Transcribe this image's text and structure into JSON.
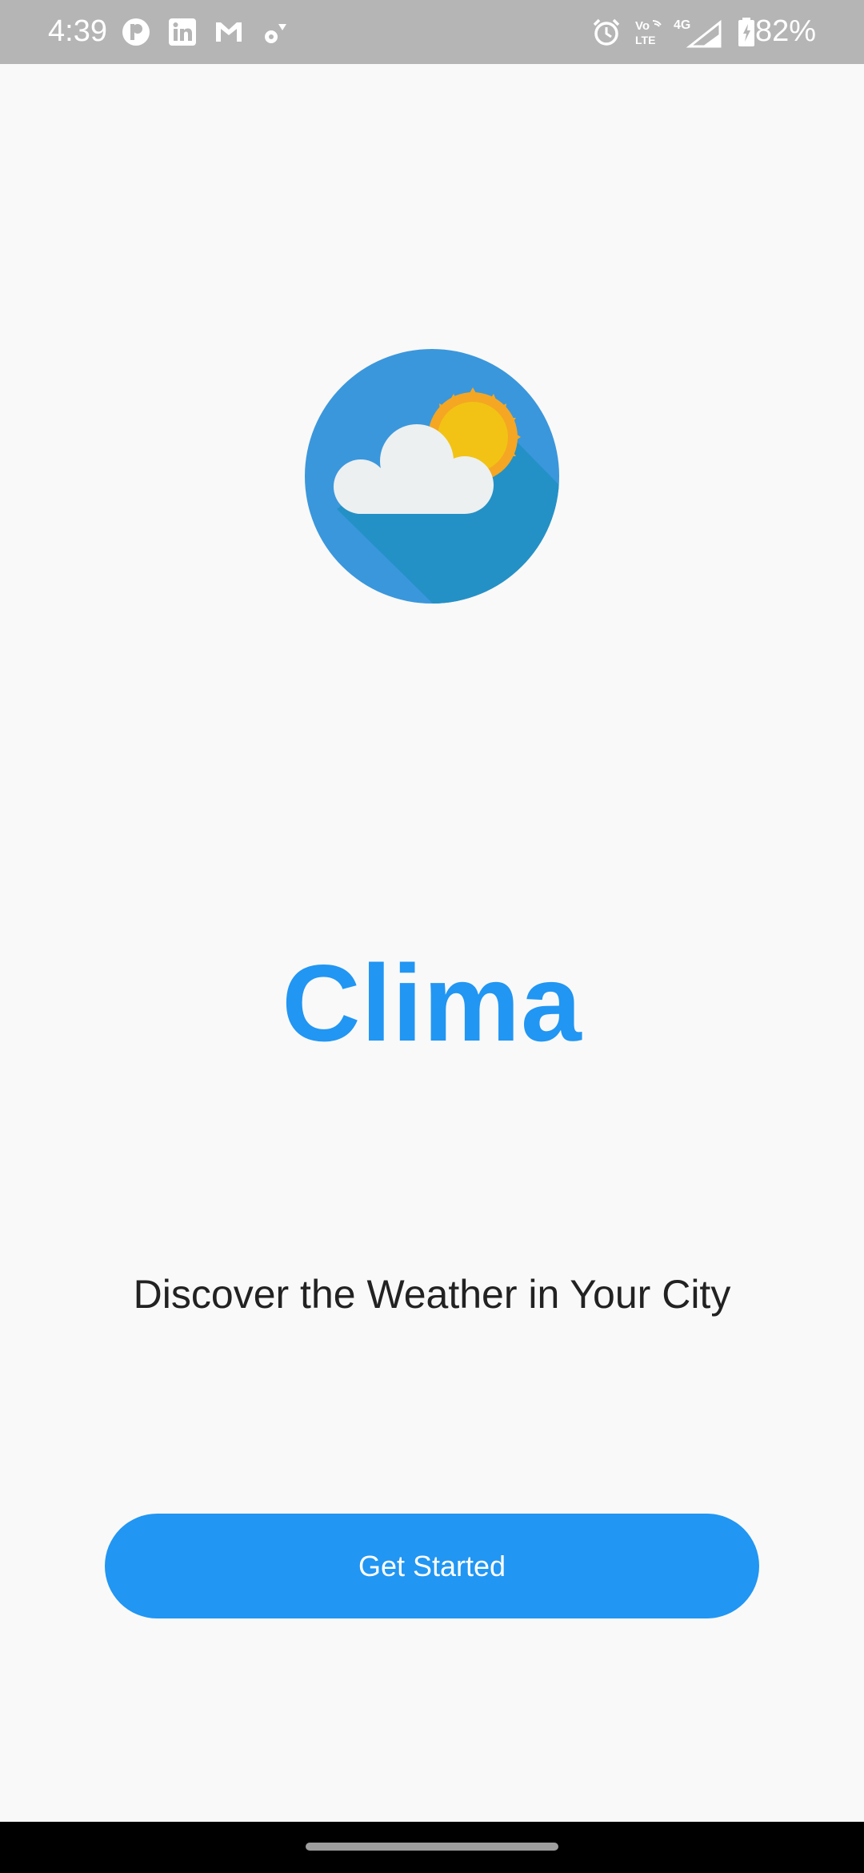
{
  "status_bar": {
    "time": "4:39",
    "battery": "82%",
    "left_icons": [
      "notification-app-icon",
      "linkedin-icon",
      "gmail-icon",
      "settings-sync-icon"
    ],
    "right_icons": [
      "alarm-icon",
      "volte-icon",
      "signal-4g-icon",
      "battery-icon"
    ],
    "network_label": "4G",
    "volte_label": "Vo LTE"
  },
  "app": {
    "title": "Clima",
    "tagline": "Discover the Weather in Your City",
    "cta_label": "Get Started"
  },
  "colors": {
    "accent": "#2196f3",
    "logo_circle": "#3a97dc",
    "logo_shadow": "#2491c6",
    "sun": "#f2c314",
    "sun_rays": "#f5a623",
    "cloud": "#ecf0f1",
    "background": "#f9f9f9",
    "status_bar": "#b5b5b5"
  }
}
